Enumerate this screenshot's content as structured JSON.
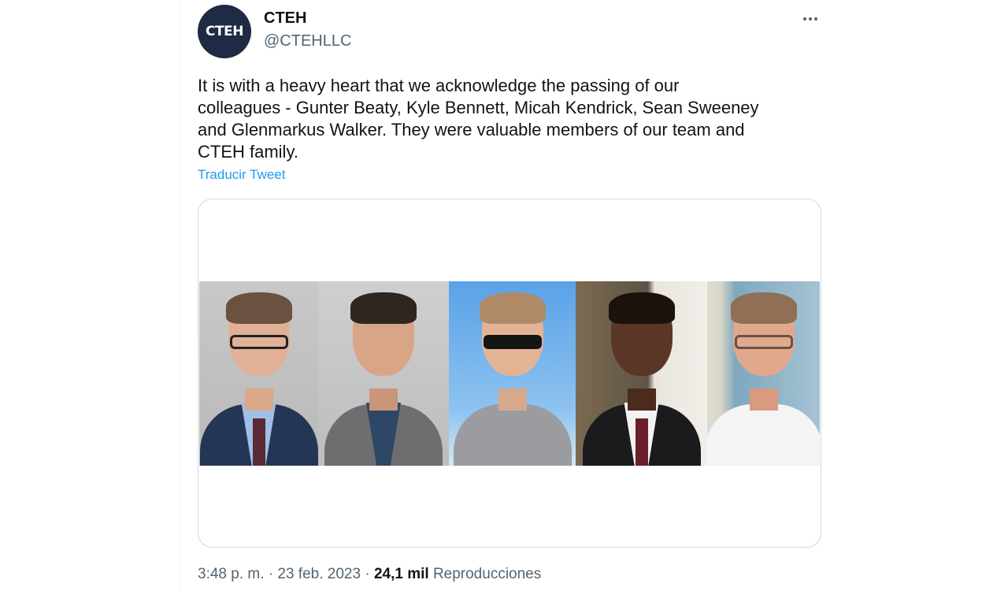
{
  "author": {
    "name": "CTEH",
    "handle": "@CTEHLLC",
    "avatar_text": "CTEH"
  },
  "tweet": {
    "text": "It is with a heavy heart that we acknowledge the passing of our\ncolleagues - Gunter Beaty, Kyle Bennett, Micah Kendrick, Sean Sweeney\nand Glenmarkus Walker. They were valuable members of our team and\nCTEH family.",
    "translate_label": "Traducir Tweet"
  },
  "meta": {
    "time": "3:48 p. m.",
    "separator": "·",
    "date": "23 feb. 2023",
    "views_count": "24,1 mil",
    "views_label": "Reproducciones"
  },
  "colors": {
    "link": "#1d9bf0",
    "secondary_text": "#536471",
    "avatar_bg": "#1f2a44"
  },
  "icons": {
    "more": "more-options-icon"
  }
}
